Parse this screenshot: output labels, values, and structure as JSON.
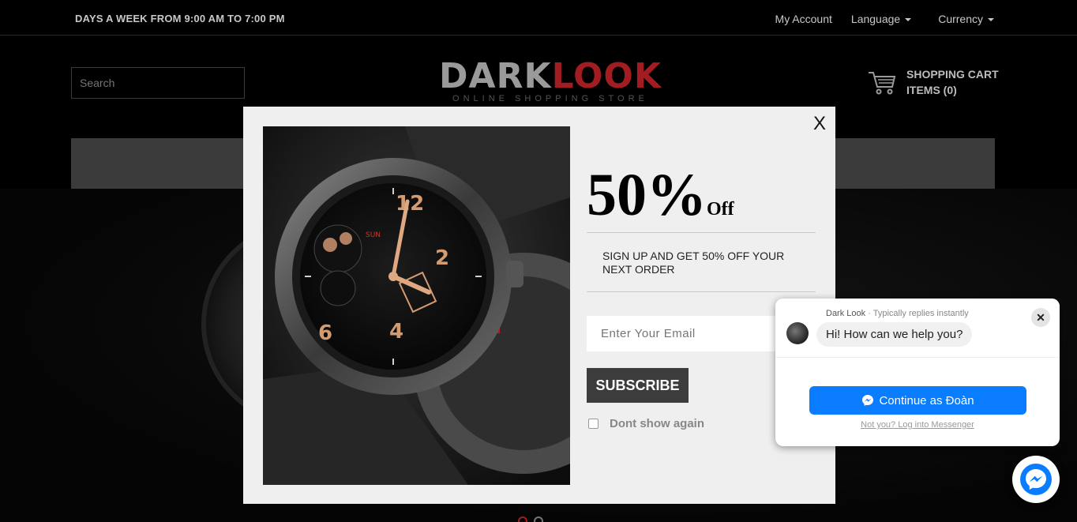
{
  "topbar": {
    "hours": "DAYS A WEEK FROM 9:00 AM TO 7:00 PM",
    "my_account": "My Account",
    "language": "Language",
    "currency": "Currency"
  },
  "header": {
    "search_placeholder": "Search",
    "logo_dark": "DARK",
    "logo_look": "LOOK",
    "logo_tagline": "ONLINE SHOPPING STORE",
    "cart_title": "SHOPPING CART",
    "cart_items": "ITEMS (0)"
  },
  "popup": {
    "close": "X",
    "headline_pct": "50%",
    "headline_off": "Off",
    "text": "SIGN UP AND GET 50% OFF YOUR NEXT ORDER",
    "email_placeholder": "Enter Your Email",
    "subscribe": "SUBSCRIBE",
    "dont_show": "Dont show again"
  },
  "messenger": {
    "page_name": "Dark Look",
    "status": " · Typically replies instantly",
    "greeting": "Hi! How can we help you?",
    "continue": "Continue as Đoàn",
    "not_you": "Not you? Log into Messenger",
    "close": "✕"
  },
  "colors": {
    "accent_red": "#a11d21",
    "messenger_blue": "#0a7cff"
  }
}
